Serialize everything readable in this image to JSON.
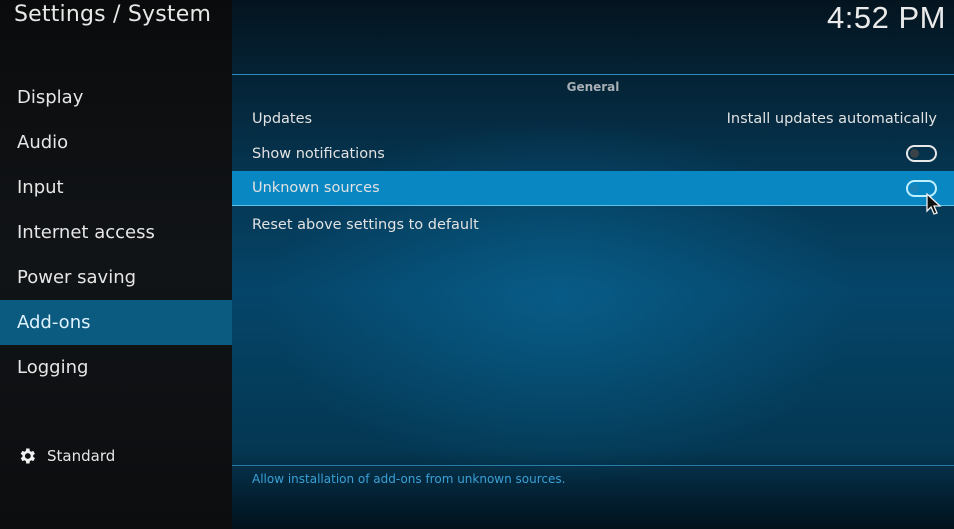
{
  "header": {
    "title": "Settings / System",
    "clock": "4:52 PM"
  },
  "sidebar": {
    "items": [
      {
        "label": "Display",
        "active": false
      },
      {
        "label": "Audio",
        "active": false
      },
      {
        "label": "Input",
        "active": false
      },
      {
        "label": "Internet access",
        "active": false
      },
      {
        "label": "Power saving",
        "active": false
      },
      {
        "label": "Add-ons",
        "active": true
      },
      {
        "label": "Logging",
        "active": false
      }
    ],
    "settings_level": {
      "icon": "gear-icon",
      "label": "Standard"
    }
  },
  "main": {
    "section_title": "General",
    "settings": [
      {
        "label": "Updates",
        "value": "Install updates automatically",
        "type": "select"
      },
      {
        "label": "Show notifications",
        "type": "toggle",
        "enabled": false
      },
      {
        "label": "Unknown sources",
        "type": "toggle",
        "enabled": false,
        "focused": true
      },
      {
        "label": "Reset above settings to default",
        "type": "action"
      }
    ],
    "description": "Allow installation of add-ons from unknown sources."
  },
  "colors": {
    "accent": "#0887c3",
    "sidebar_active": "#0b5a80",
    "description_text": "#3aa0d6"
  }
}
